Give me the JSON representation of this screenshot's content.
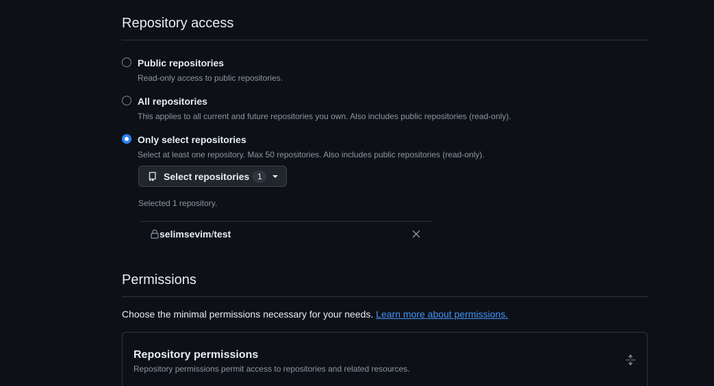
{
  "repository_access": {
    "title": "Repository access",
    "options": [
      {
        "label": "Public repositories",
        "description": "Read-only access to public repositories.",
        "checked": false
      },
      {
        "label": "All repositories",
        "description": "This applies to all current and future repositories you own. Also includes public repositories (read-only).",
        "checked": false
      },
      {
        "label": "Only select repositories",
        "description": "Select at least one repository. Max 50 repositories. Also includes public repositories (read-only).",
        "checked": true
      }
    ],
    "select_button": {
      "label": "Select repositories",
      "count": "1"
    },
    "selected_text": "Selected 1 repository.",
    "selected_repos": [
      {
        "owner": "selimsevim",
        "separator": "/",
        "name": "test"
      }
    ]
  },
  "permissions": {
    "title": "Permissions",
    "intro": "Choose the minimal permissions necessary for your needs.",
    "learn_more_link": "Learn more about permissions.",
    "repository_permissions": {
      "title": "Repository permissions",
      "description": "Repository permissions permit access to repositories and related resources."
    }
  },
  "colors": {
    "background": "#0d1117",
    "accent": "#2f81f7",
    "link": "#4493f8",
    "border": "#30363d"
  }
}
